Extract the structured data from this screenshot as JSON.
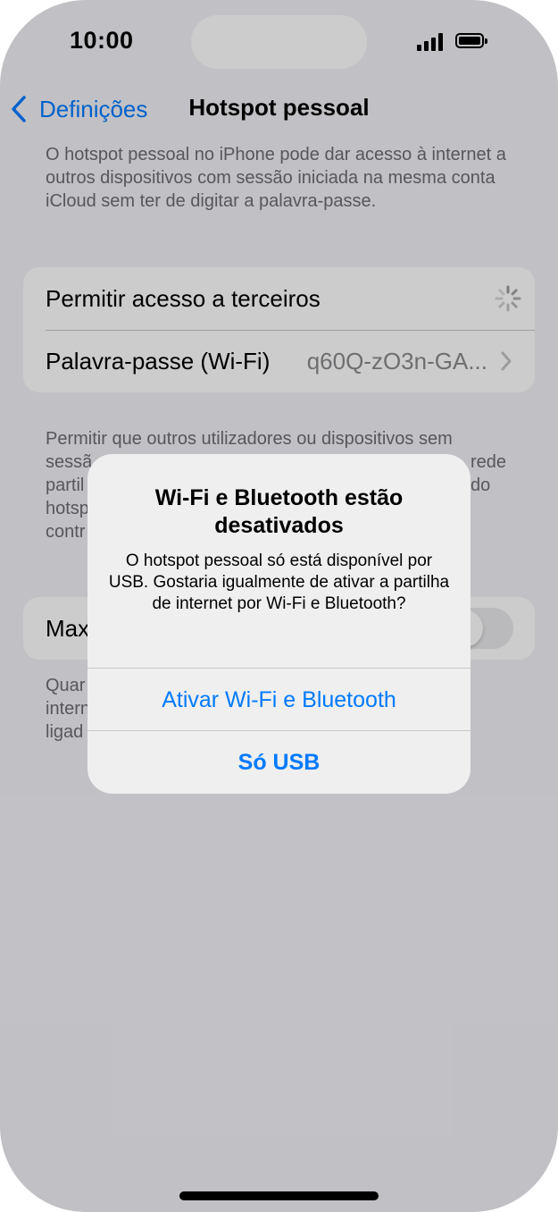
{
  "status_bar": {
    "time": "10:00"
  },
  "nav": {
    "back_label": "Definições",
    "title": "Hotspot pessoal"
  },
  "intro_text": "O hotspot pessoal no iPhone pode dar acesso à internet a outros dispositivos com sessão iniciada na mesma conta iCloud sem ter de digitar a palavra-passe.",
  "settings": {
    "allow_others_label": "Permitir acesso a terceiros",
    "password_label": "Palavra-passe (Wi-Fi)",
    "password_value": "q60Q-zO3n-GA..."
  },
  "allow_footer": {
    "line1": "Permitir que outros utilizadores ou dispositivos sem",
    "line2_left": "sessã",
    "line2_right": "rede",
    "line3_left": "partil",
    "line3_right": "do",
    "line4_left": "hotsp",
    "line5_left": "contr"
  },
  "maximize": {
    "label_partial": "Max",
    "enabled": false
  },
  "maximize_footer": {
    "line1": "Quar",
    "line2": "intern",
    "line3": "ligad"
  },
  "alert": {
    "title": "Wi-Fi e Bluetooth estão desativados",
    "message": "O hotspot pessoal só está disponível por USB. Gostaria igualmente de ativar a partilha de internet por Wi-Fi e Bluetooth?",
    "primary_button": "Ativar Wi-Fi e Bluetooth",
    "secondary_button": "Só USB"
  },
  "colors": {
    "accent": "#007aff",
    "background": "#f2f2f7",
    "secondary_text": "#6d6d72"
  }
}
